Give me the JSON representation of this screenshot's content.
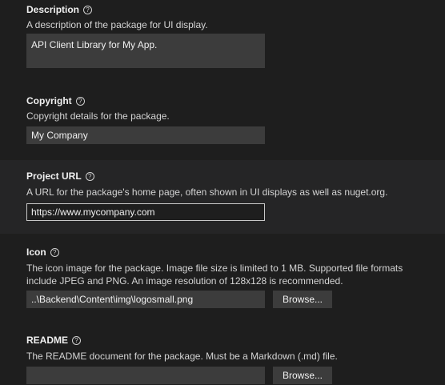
{
  "description": {
    "title": "Description",
    "help_icon": "?",
    "text": "A description of the package for UI display.",
    "value": "API Client Library for My App."
  },
  "copyright": {
    "title": "Copyright",
    "help_icon": "?",
    "text": "Copyright details for the package.",
    "value": "My Company"
  },
  "project_url": {
    "title": "Project URL",
    "help_icon": "?",
    "text": "A URL for the package's home page, often shown in UI displays as well as nuget.org.",
    "value": "https://www.mycompany.com"
  },
  "icon": {
    "title": "Icon",
    "help_icon": "?",
    "text_line1": "The icon image for the package. Image file size is limited to 1 MB. Supported file formats",
    "text_line2": "include JPEG and PNG. An image resolution of 128x128 is recommended.",
    "value": "..\\Backend\\Content\\img\\logosmall.png",
    "browse_label": "Browse..."
  },
  "readme": {
    "title": "README",
    "help_icon": "?",
    "text": "The README document for the package. Must be a Markdown (.md) file.",
    "value": "",
    "browse_label": "Browse..."
  }
}
